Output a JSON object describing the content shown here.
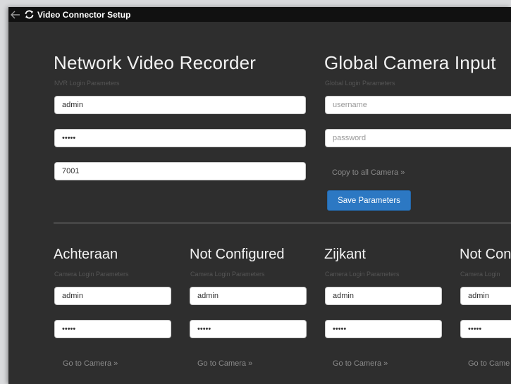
{
  "window": {
    "title": "Video Connector Setup"
  },
  "nvr": {
    "heading": "Network Video Recorder",
    "subheading": "NVR Login Parameters",
    "username": "admin",
    "password": "•••••",
    "port": "7001"
  },
  "global": {
    "heading": "Global Camera Input",
    "subheading": "Global Login Parameters",
    "username_placeholder": "username",
    "password_placeholder": "password",
    "copy_link": "Copy to all Camera »",
    "save_button": "Save Parameters"
  },
  "cameras": [
    {
      "name": "Achteraan",
      "subheading": "Camera Login Parameters",
      "username": "admin",
      "password": "•••••",
      "link": "Go to Camera »"
    },
    {
      "name": "Not Configured",
      "subheading": "Camera Login Parameters",
      "username": "admin",
      "password": "•••••",
      "link": "Go to Camera »"
    },
    {
      "name": "Zijkant",
      "subheading": "Camera Login Parameters",
      "username": "admin",
      "password": "•••••",
      "link": "Go to Camera »"
    },
    {
      "name": "Not Con",
      "subheading": "Camera Login",
      "username": "admin",
      "password": "•••••",
      "link": "Go to Came"
    }
  ],
  "icons": {
    "back": "back-arrow-icon",
    "refresh": "refresh-icon"
  }
}
